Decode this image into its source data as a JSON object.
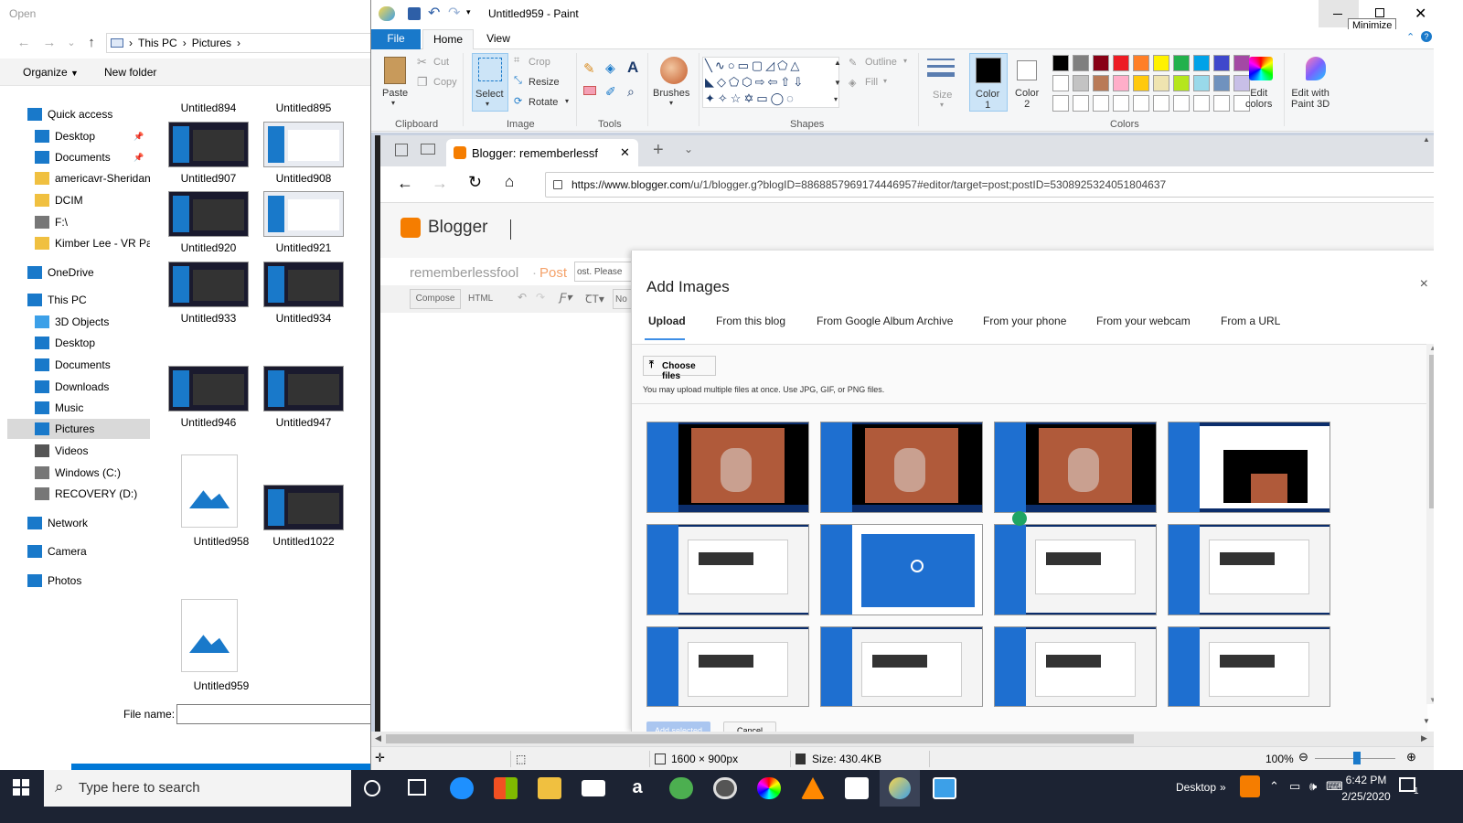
{
  "explorer": {
    "title": "Open",
    "breadcrumb": [
      "This PC",
      "Pictures"
    ],
    "commands": {
      "organize": "Organize",
      "new_folder": "New folder"
    },
    "nav": [
      {
        "label": "Quick access",
        "icon": "star-icon"
      },
      {
        "label": "Desktop",
        "icon": "desktop-folder-icon",
        "pinned": true
      },
      {
        "label": "Documents",
        "icon": "documents-folder-icon",
        "pinned": true
      },
      {
        "label": "americavr-Sheridan",
        "icon": "folder-icon"
      },
      {
        "label": "DCIM",
        "icon": "folder-icon"
      },
      {
        "label": "F:\\",
        "icon": "drive-icon"
      },
      {
        "label": "Kimber Lee - VR Pac",
        "icon": "folder-icon"
      },
      {
        "label": "OneDrive",
        "icon": "cloud-icon"
      },
      {
        "label": "This PC",
        "icon": "computer-icon"
      },
      {
        "label": "3D Objects",
        "icon": "3d-objects-icon"
      },
      {
        "label": "Desktop",
        "icon": "desktop-folder-icon"
      },
      {
        "label": "Documents",
        "icon": "documents-folder-icon"
      },
      {
        "label": "Downloads",
        "icon": "download-icon"
      },
      {
        "label": "Music",
        "icon": "music-icon"
      },
      {
        "label": "Pictures",
        "icon": "pictures-folder-icon",
        "selected": true
      },
      {
        "label": "Videos",
        "icon": "videos-folder-icon"
      },
      {
        "label": "Windows (C:)",
        "icon": "drive-icon"
      },
      {
        "label": "RECOVERY (D:)",
        "icon": "drive-icon"
      },
      {
        "label": "Network",
        "icon": "network-icon"
      },
      {
        "label": "Camera",
        "icon": "camera-folder-icon"
      },
      {
        "label": "Photos",
        "icon": "photos-folder-icon"
      }
    ],
    "files": [
      "Untitled894",
      "Untitled895",
      "Untitled907",
      "Untitled908",
      "Untitled920",
      "Untitled921",
      "Untitled933",
      "Untitled934",
      "Untitled946",
      "Untitled947",
      "Untitled958",
      "Untitled1022",
      "Untitled959"
    ],
    "file_name_label": "File name:",
    "file_name_value": ""
  },
  "paint": {
    "title": "Untitled959 - Paint",
    "tabs": [
      "File",
      "Home",
      "View"
    ],
    "clipboard": {
      "paste": "Paste",
      "cut": "Cut",
      "copy": "Copy",
      "group": "Clipboard"
    },
    "image": {
      "select": "Select",
      "crop": "Crop",
      "resize": "Resize",
      "rotate": "Rotate",
      "group": "Image"
    },
    "tools": {
      "group": "Tools"
    },
    "brushes": "Brushes",
    "shapes": {
      "outline": "Outline",
      "fill": "Fill",
      "group": "Shapes"
    },
    "size": "Size",
    "color1": "Color\n1",
    "color2": "Color\n2",
    "colors": {
      "group": "Colors",
      "edit": "Edit\ncolors",
      "paint3d": "Edit with\nPaint 3D"
    },
    "palette_row1": [
      "#000000",
      "#7f7f7f",
      "#880015",
      "#ed1c24",
      "#ff7f27",
      "#fff200",
      "#22b14c",
      "#00a2e8",
      "#3f48cc",
      "#a349a4"
    ],
    "palette_row2": [
      "#ffffff",
      "#c3c3c3",
      "#b97a57",
      "#ffaec9",
      "#ffc90e",
      "#efe4b0",
      "#b5e61d",
      "#99d9ea",
      "#7092be",
      "#c8bfe7"
    ],
    "tooltip": "Minimize",
    "status": {
      "dimensions": "1600 × 900px",
      "size": "Size: 430.4KB",
      "zoom": "100%"
    }
  },
  "browser": {
    "tab_title": "Blogger: rememberlessf",
    "url_host": "https://www.blogger.com",
    "url_rest": "/u/1/blogger.g?blogID=8868857969174446957#editor/target=post;postID=5308925324051804637",
    "brand": "Blogger",
    "blog_name": "rememberlessfool",
    "post_label": "Post",
    "title_placeholder": "ost. Please",
    "compose": "Compose",
    "html": "HTML",
    "normal": "No"
  },
  "dialog": {
    "title": "Add Images",
    "close": "×",
    "tabs": [
      "Upload",
      "From this blog",
      "From Google Album Archive",
      "From your phone",
      "From your webcam",
      "From a URL"
    ],
    "choose_files": "Choose files",
    "hint": "You may upload multiple files at once. Use JPG, GIF, or PNG files.",
    "add_selected": "Add selected",
    "cancel": "Cancel"
  },
  "taskbar": {
    "search_placeholder": "Type here to search",
    "desktop_label": "Desktop",
    "time": "6:42 PM",
    "date": "2/25/2020",
    "notification_count": "1"
  }
}
